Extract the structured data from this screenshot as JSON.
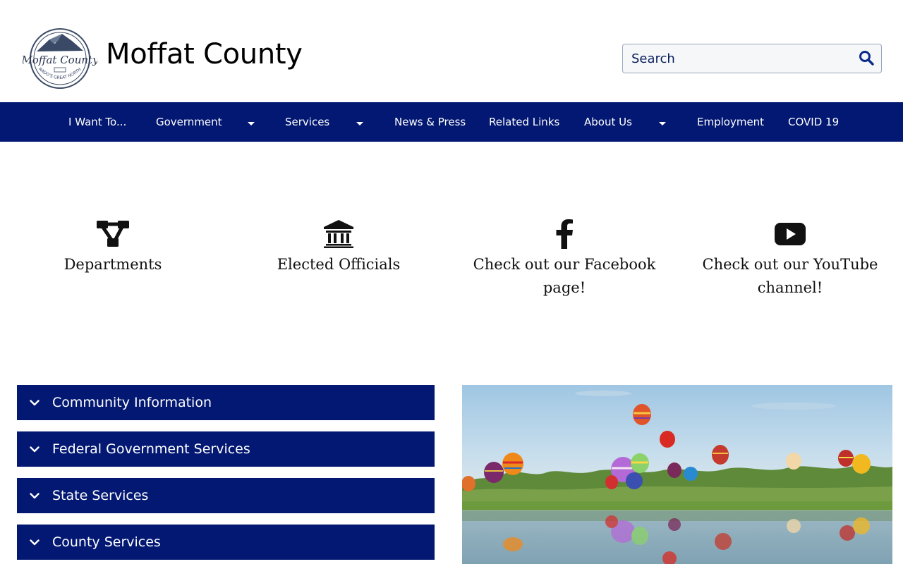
{
  "header": {
    "title": "Moffat County",
    "logo_text": "Moffat County",
    "logo_subtext": "COLORADO'S GREAT NORTHWEST",
    "search_placeholder": "Search"
  },
  "nav": {
    "items": [
      {
        "label": "I Want To...",
        "has_dropdown": false
      },
      {
        "label": "Government",
        "has_dropdown": true
      },
      {
        "label": "Services",
        "has_dropdown": true
      },
      {
        "label": "News & Press",
        "has_dropdown": false
      },
      {
        "label": "Related Links",
        "has_dropdown": false
      },
      {
        "label": "About Us",
        "has_dropdown": true
      },
      {
        "label": "Employment",
        "has_dropdown": false
      },
      {
        "label": "COVID 19",
        "has_dropdown": false
      }
    ]
  },
  "quick_links": [
    {
      "label": "Departments",
      "icon": "sitemap-icon"
    },
    {
      "label": "Elected Officials",
      "icon": "courthouse-icon"
    },
    {
      "label": "Check out our Facebook page!",
      "icon": "facebook-icon"
    },
    {
      "label": "Check out our YouTube channel!",
      "icon": "youtube-icon"
    }
  ],
  "accordion": [
    {
      "label": "Community Information"
    },
    {
      "label": "Federal Government Services"
    },
    {
      "label": "State Services"
    },
    {
      "label": "County Services"
    }
  ],
  "colors": {
    "brand_navy": "#031872",
    "white": "#ffffff"
  }
}
